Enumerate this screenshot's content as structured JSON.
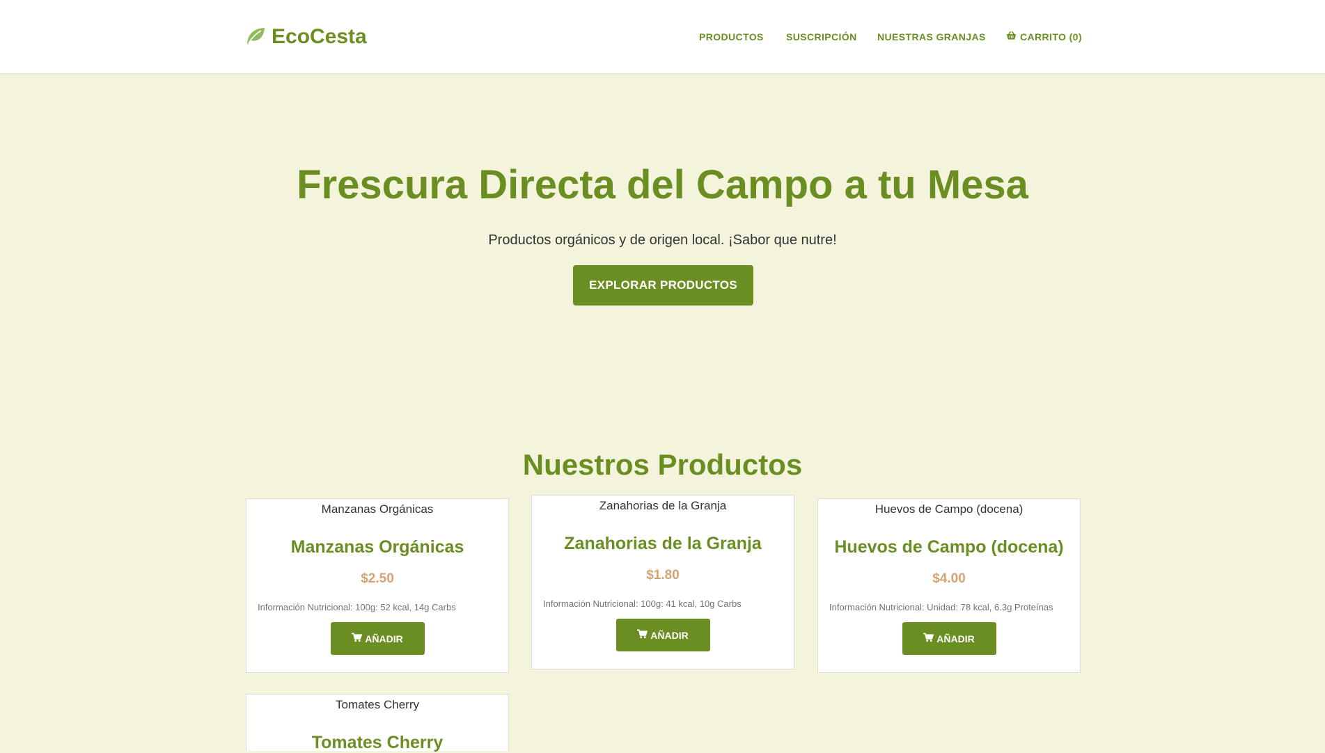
{
  "header": {
    "logo_text": "EcoCesta",
    "nav": [
      {
        "label": "PRODUCTOS"
      },
      {
        "label": "SUSCRIPCIÓN"
      },
      {
        "label": "NUESTRAS GRANJAS"
      },
      {
        "label": "CARRITO (0)"
      }
    ]
  },
  "hero": {
    "title": "Frescura Directa del Campo a tu Mesa",
    "subtitle": "Productos orgánicos y de origen local. ¡Sabor que nutre!",
    "cta_label": "EXPLORAR PRODUCTOS"
  },
  "products_section": {
    "title": "Nuestros Productos",
    "add_label": "AÑADIR",
    "items": [
      {
        "image_alt": "Manzanas Orgánicas",
        "name": "Manzanas Orgánicas",
        "price": "$2.50",
        "nutrition": "Información Nutricional: 100g: 52 kcal, 14g Carbs"
      },
      {
        "image_alt": "Zanahorias de la Granja",
        "name": "Zanahorias de la Granja",
        "price": "$1.80",
        "nutrition": "Información Nutricional: 100g: 41 kcal, 10g Carbs"
      },
      {
        "image_alt": "Huevos de Campo (docena)",
        "name": "Huevos de Campo (docena)",
        "price": "$4.00",
        "nutrition": "Información Nutricional: Unidad: 78 kcal, 6.3g Proteínas"
      },
      {
        "image_alt": "Tomates Cherry",
        "name": "Tomates Cherry"
      }
    ]
  },
  "colors": {
    "brand_green": "#6b8e23",
    "background": "#f4f4dd",
    "price": "#d4a373",
    "logo_leaf": "#8fbc5a"
  },
  "icons": {
    "logo": "leaf-icon",
    "cart": "shopping-basket-icon",
    "add": "cart-icon"
  }
}
